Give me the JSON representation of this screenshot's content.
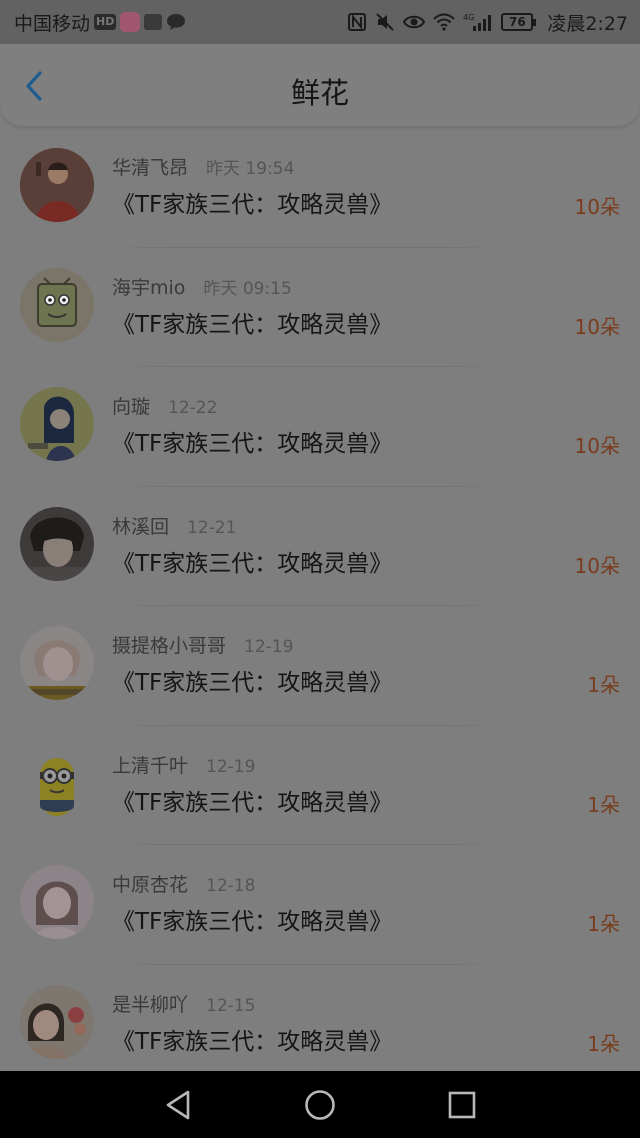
{
  "status_bar": {
    "carrier": "中国移动",
    "hd_badge": "HD",
    "battery_level": "76",
    "time": "凌晨2:27",
    "icons": [
      "nfc-icon",
      "mute-icon",
      "eye-icon",
      "wifi-icon",
      "4g-signal-icon",
      "battery-icon"
    ]
  },
  "header": {
    "title": "鲜花",
    "back_icon": "chevron-left-icon",
    "accent_color": "#1e5b8f"
  },
  "colors": {
    "count": "#7a3c1c",
    "dim_overlay": "#7f7f7f"
  },
  "list": [
    {
      "username": "华清飞昂",
      "time": "昨天 19:54",
      "book": "《TF家族三代：攻略灵兽》",
      "count": "10朵"
    },
    {
      "username": "海宇mio",
      "time": "昨天 09:15",
      "book": "《TF家族三代：攻略灵兽》",
      "count": "10朵"
    },
    {
      "username": "向璇",
      "time": "12-22",
      "book": "《TF家族三代：攻略灵兽》",
      "count": "10朵"
    },
    {
      "username": "林溪回",
      "time": "12-21",
      "book": "《TF家族三代：攻略灵兽》",
      "count": "10朵"
    },
    {
      "username": "摄提格小哥哥",
      "time": "12-19",
      "book": "《TF家族三代：攻略灵兽》",
      "count": "1朵"
    },
    {
      "username": "上清千叶",
      "time": "12-19",
      "book": "《TF家族三代：攻略灵兽》",
      "count": "1朵"
    },
    {
      "username": "中原杏花",
      "time": "12-18",
      "book": "《TF家族三代：攻略灵兽》",
      "count": "1朵"
    },
    {
      "username": "是半柳吖",
      "time": "12-15",
      "book": "《TF家族三代：攻略灵兽》",
      "count": "1朵"
    }
  ],
  "nav_bar": {
    "back": "triangle-back-icon",
    "home": "circle-home-icon",
    "recents": "square-recents-icon"
  }
}
